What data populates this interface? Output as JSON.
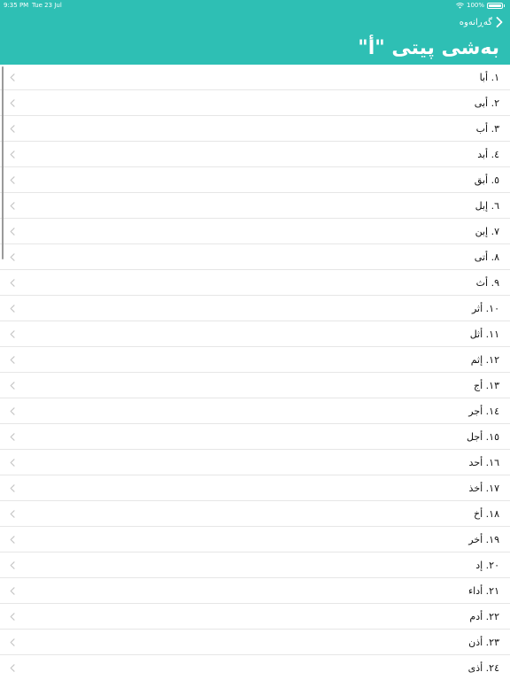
{
  "status_bar": {
    "time": "9:35 PM",
    "date": "Tue 23 Jul",
    "battery": "100%"
  },
  "nav": {
    "back_label": "گەڕانەوە",
    "title": "بەشی پیتی \"أ\""
  },
  "colors": {
    "header_bg": "#2ebfb4",
    "row_divider": "#e6e6e6",
    "chevron": "#c4c4c4"
  },
  "items": [
    {
      "label": "١. أبا"
    },
    {
      "label": "٢. أبى"
    },
    {
      "label": "٣. أب"
    },
    {
      "label": "٤. أبد"
    },
    {
      "label": "٥. أبق"
    },
    {
      "label": "٦. إبل"
    },
    {
      "label": "٧. إبن"
    },
    {
      "label": "٨. أتى"
    },
    {
      "label": "٩. أث"
    },
    {
      "label": "١٠. أثر"
    },
    {
      "label": "١١. أثل"
    },
    {
      "label": "١٢. إثم"
    },
    {
      "label": "١٣. أج"
    },
    {
      "label": "١٤. أجر"
    },
    {
      "label": "١٥. أجل"
    },
    {
      "label": "١٦. أحد"
    },
    {
      "label": "١٧. أخذ"
    },
    {
      "label": "١٨. أخ"
    },
    {
      "label": "١٩. أخر"
    },
    {
      "label": "٢٠. إد"
    },
    {
      "label": "٢١. أداء"
    },
    {
      "label": "٢٢. أدم"
    },
    {
      "label": "٢٣. أذن"
    },
    {
      "label": "٢٤. أذى"
    }
  ]
}
